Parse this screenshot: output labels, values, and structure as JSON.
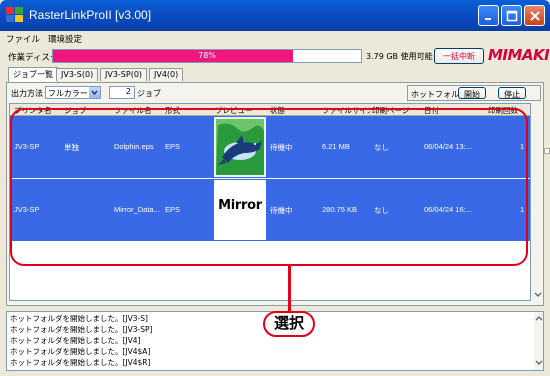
{
  "window": {
    "title": "RasterLinkProII  [v3.00]"
  },
  "menu": [
    "ファイル",
    "環境設定"
  ],
  "disk": {
    "label": "作業ディスク(C:)",
    "usage_percent": 78,
    "usage_text": "78%",
    "free_text": "3.79 GB 使用可能",
    "cancel_all_label": "一括中断",
    "logo": "MIMAKI",
    "fill_color": "#f0157f"
  },
  "tabs": [
    {
      "label": "ジョブ一覧",
      "active": true
    },
    {
      "label": "JV3-S(0)",
      "active": false
    },
    {
      "label": "JV3-SP(0)",
      "active": false
    },
    {
      "label": "JV4(0)",
      "active": false
    }
  ],
  "toolbar": {
    "output_label": "出力方法",
    "output_value": "フルカラー",
    "job_count": "2",
    "job_unit": "ジョブ",
    "hotfolder_label": "ホットフォルダ",
    "start_label": "開始",
    "stop_label": "停止"
  },
  "table": {
    "headers": [
      "プリンタ名",
      "ジョブ",
      "ファイル名",
      "形式",
      "プレビュー",
      "状態",
      "ファイルサイズ",
      "印刷ページ",
      "日付",
      "印刷回数"
    ],
    "rows": [
      {
        "printer": "JV3-SP",
        "job": "単独",
        "file": "Dolphin.eps",
        "format": "EPS",
        "preview": "dolphin-image",
        "status": "待機中",
        "size": "6.21 MB",
        "pages": "なし",
        "date": "06/04/24 13:...",
        "copies": "1"
      },
      {
        "printer": "JV3-SP",
        "job": "",
        "file": "Mirror_Data...",
        "format": "EPS",
        "preview": "Mirror",
        "status": "待機中",
        "size": "280.75 KB",
        "pages": "なし",
        "date": "06/04/24 16:...",
        "copies": "1"
      }
    ],
    "selection_color": "#3969e6"
  },
  "log": [
    "ホットフォルダを開始しました。[JV3-S]",
    "ホットフォルダを開始しました。[JV3-SP]",
    "ホットフォルダを開始しました。[JV4]",
    "ホットフォルダを開始しました。[JV4$A]",
    "ホットフォルダを開始しました。[JV4$R]"
  ],
  "annotation": {
    "label": "選択",
    "color": "#e0001b"
  }
}
